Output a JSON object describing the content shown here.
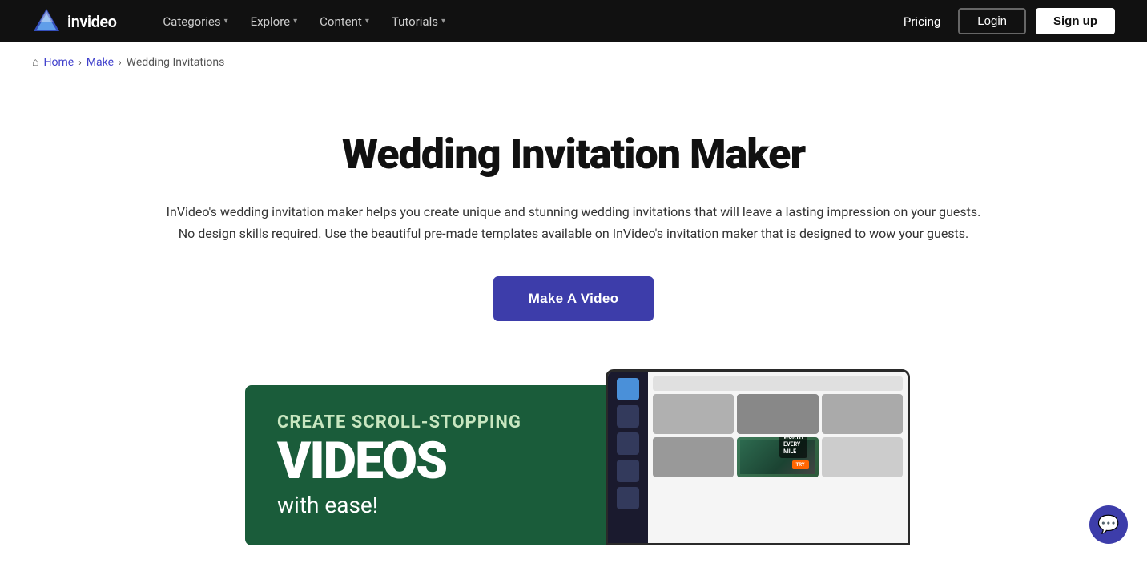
{
  "navbar": {
    "logo_text": "invideo",
    "nav_items": [
      {
        "label": "Categories",
        "has_dropdown": true
      },
      {
        "label": "Explore",
        "has_dropdown": true
      },
      {
        "label": "Content",
        "has_dropdown": true
      },
      {
        "label": "Tutorials",
        "has_dropdown": true
      }
    ],
    "pricing_label": "Pricing",
    "login_label": "Login",
    "signup_label": "Sign up"
  },
  "breadcrumb": {
    "home_label": "Home",
    "make_label": "Make",
    "current_label": "Wedding Invitations"
  },
  "hero": {
    "title": "Wedding Invitation Maker",
    "description_line1": "InVideo's wedding invitation maker helps you create unique and stunning wedding invitations that will leave a lasting impression on your guests.",
    "description_line2": "No design skills required. Use the beautiful pre-made templates available on InVideo's invitation maker that is designed to wow your guests.",
    "cta_label": "Make A Video"
  },
  "preview": {
    "scroll_stopping": "CREATE SCROLL-STOPPING",
    "videos": "VIDEOS",
    "with_ease": "with ease!",
    "worth_every_mile": "WORTH\nEVERY\nMILE",
    "orange_btn": "Try Now"
  },
  "chat": {
    "icon": "💬"
  }
}
